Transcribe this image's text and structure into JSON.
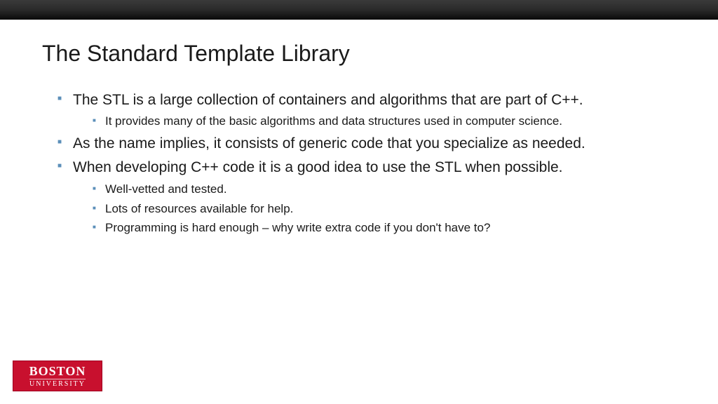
{
  "title": "The Standard Template Library",
  "bullets": [
    {
      "text": "The STL is a large collection of containers and algorithms that are part of C++.",
      "sub": [
        "It provides many of the basic algorithms and data structures used in computer science."
      ]
    },
    {
      "text": "As the name implies, it consists of generic code that you specialize as needed.",
      "sub": []
    },
    {
      "text": "When developing C++ code it is a good idea to use the STL when possible.",
      "sub": [
        "Well-vetted and tested.",
        "Lots of resources available for help.",
        "Programming is hard enough – why write extra code if you don't have to?"
      ]
    }
  ],
  "logo": {
    "line1": "BOSTON",
    "line2": "UNIVERSITY"
  }
}
